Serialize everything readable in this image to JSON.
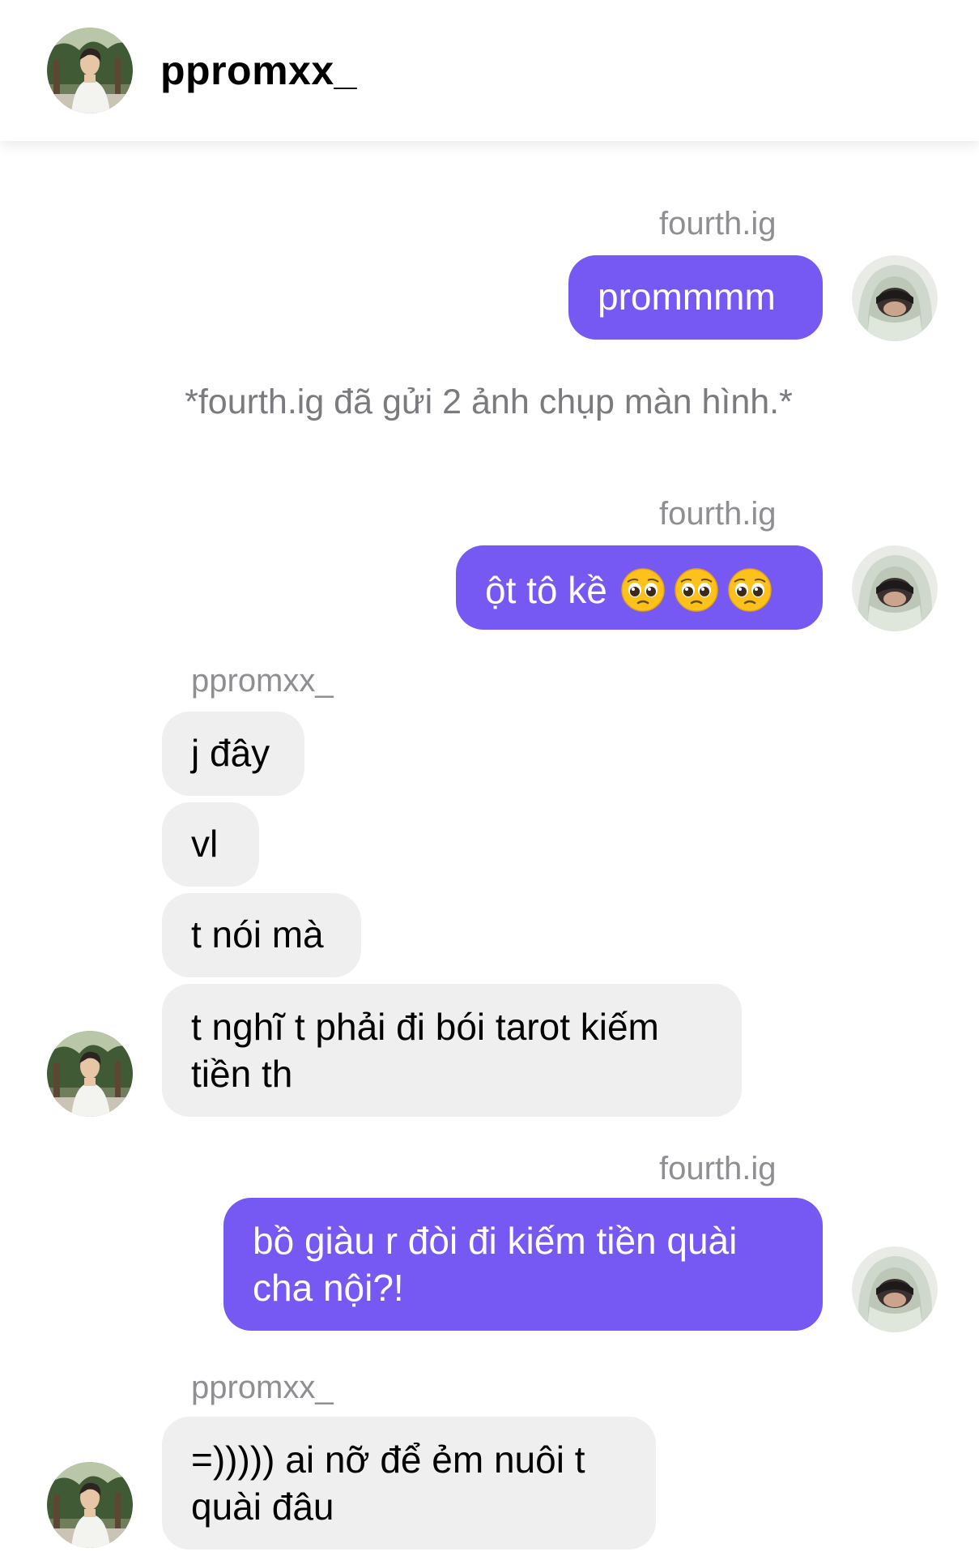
{
  "header": {
    "username": "ppromxx_",
    "avatar_icon": "profile-photo-ppromxx"
  },
  "colors": {
    "outgoing_bubble": "#7559f2",
    "incoming_bubble": "#efefef",
    "label_gray": "#8e8e93"
  },
  "messages": [
    {
      "sender": "fourth.ig",
      "text": "prommmm"
    },
    {
      "system": "*fourth.ig đã gửi 2 ảnh chụp màn hình.*"
    },
    {
      "sender": "fourth.ig",
      "text": "ột tô kề",
      "emojis": [
        "pleading-face-emoji",
        "pleading-face-emoji",
        "pleading-face-emoji"
      ]
    },
    {
      "sender": "ppromxx_",
      "texts": [
        "j đây",
        "vl",
        "t nói mà",
        "t nghĩ t phải đi bói tarot kiếm tiền th"
      ]
    },
    {
      "sender": "fourth.ig",
      "text": "bồ giàu r đòi đi kiếm tiền quài cha nội?!"
    },
    {
      "sender": "ppromxx_",
      "texts": [
        "=))))) ai nỡ để ẻm nuôi t quài đâu"
      ]
    }
  ],
  "m": {
    "l1": "fourth.ig",
    "t1": "prommmm",
    "sys": "*fourth.ig đã gửi 2 ảnh chụp màn hình.*",
    "l2": "fourth.ig",
    "t2": "ột tô kề",
    "l3": "ppromxx_",
    "t3a": "j đây",
    "t3b": "vl",
    "t3c": "t nói mà",
    "t3d_1": "t nghĩ t phải đi bói tarot kiếm",
    "t3d_2": "tiền th",
    "l4": "fourth.ig",
    "t4_1": "bồ giàu r đòi đi kiếm tiền quài",
    "t4_2": "cha nội?!",
    "l5": "ppromxx_",
    "t5_1": "=))))) ai nỡ để ẻm nuôi t",
    "t5_2": "quài đâu"
  }
}
